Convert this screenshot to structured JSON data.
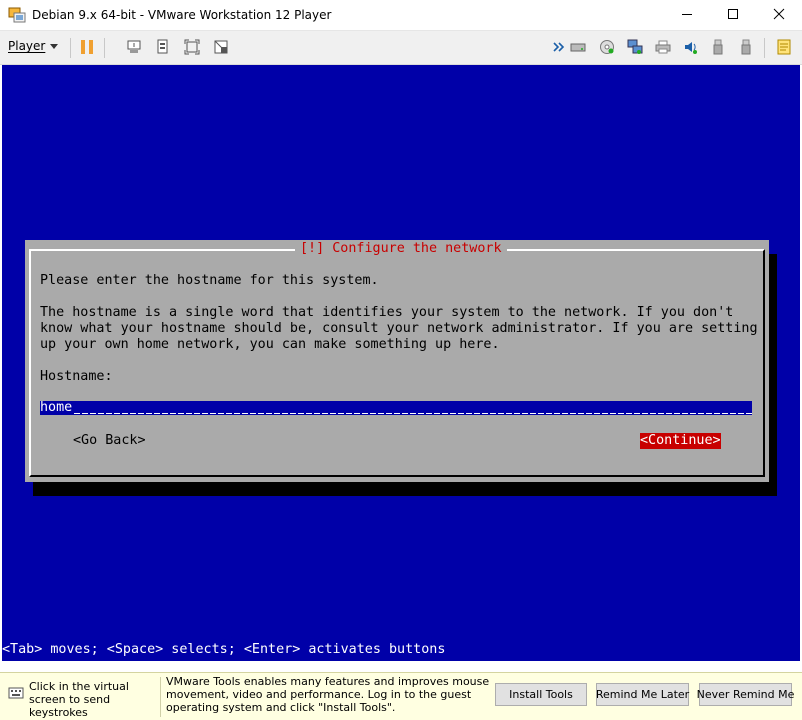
{
  "window": {
    "title": "Debian 9.x 64-bit - VMware Workstation 12 Player",
    "icons": [
      "vmware-app-icon",
      "minimize-icon",
      "maximize-icon",
      "close-icon"
    ]
  },
  "toolbar": {
    "player_label": "Player",
    "left_icons": [
      "pause-icon",
      "send-ctrl-alt-del-icon",
      "unity-icon",
      "fullscreen-icon",
      "exit-fullscreen-icon"
    ],
    "right_icons": [
      "forward-arrows-icon",
      "hard-disk-icon",
      "cd-dvd-icon",
      "network-adapter-icon",
      "printer-icon",
      "sound-card-icon",
      "usb-device-icon",
      "usb-device-icon",
      "message-log-icon"
    ]
  },
  "colors": {
    "vm_background": "#0000a8",
    "dialog_background": "#aaaaaa",
    "dialog_title": "#c80000",
    "selected_button": "#c80000",
    "notify_background": "#ffffe1"
  },
  "installer": {
    "dialog_title": "[!] Configure the network",
    "prompt": "Please enter the hostname for this system.",
    "description_lines": [
      "The hostname is a single word that identifies your system to the network. If you don't",
      "know what your hostname should be, consult your network administrator. If you are setting",
      "up your own home network, you can make something up here."
    ],
    "field_label": "Hostname:",
    "hostname_value": "home",
    "go_back_label": "<Go Back>",
    "continue_label": "<Continue>",
    "status_line": "<Tab> moves; <Space> selects; <Enter> activates buttons"
  },
  "notification": {
    "hint": "Click in the virtual screen to send keystrokes",
    "message": "VMware Tools enables many features and improves mouse movement, video and performance. Log in to the guest operating system and click \"Install Tools\".",
    "install_label": "Install Tools",
    "remind_later_label": "Remind Me Later",
    "never_remind_label": "Never Remind Me"
  }
}
